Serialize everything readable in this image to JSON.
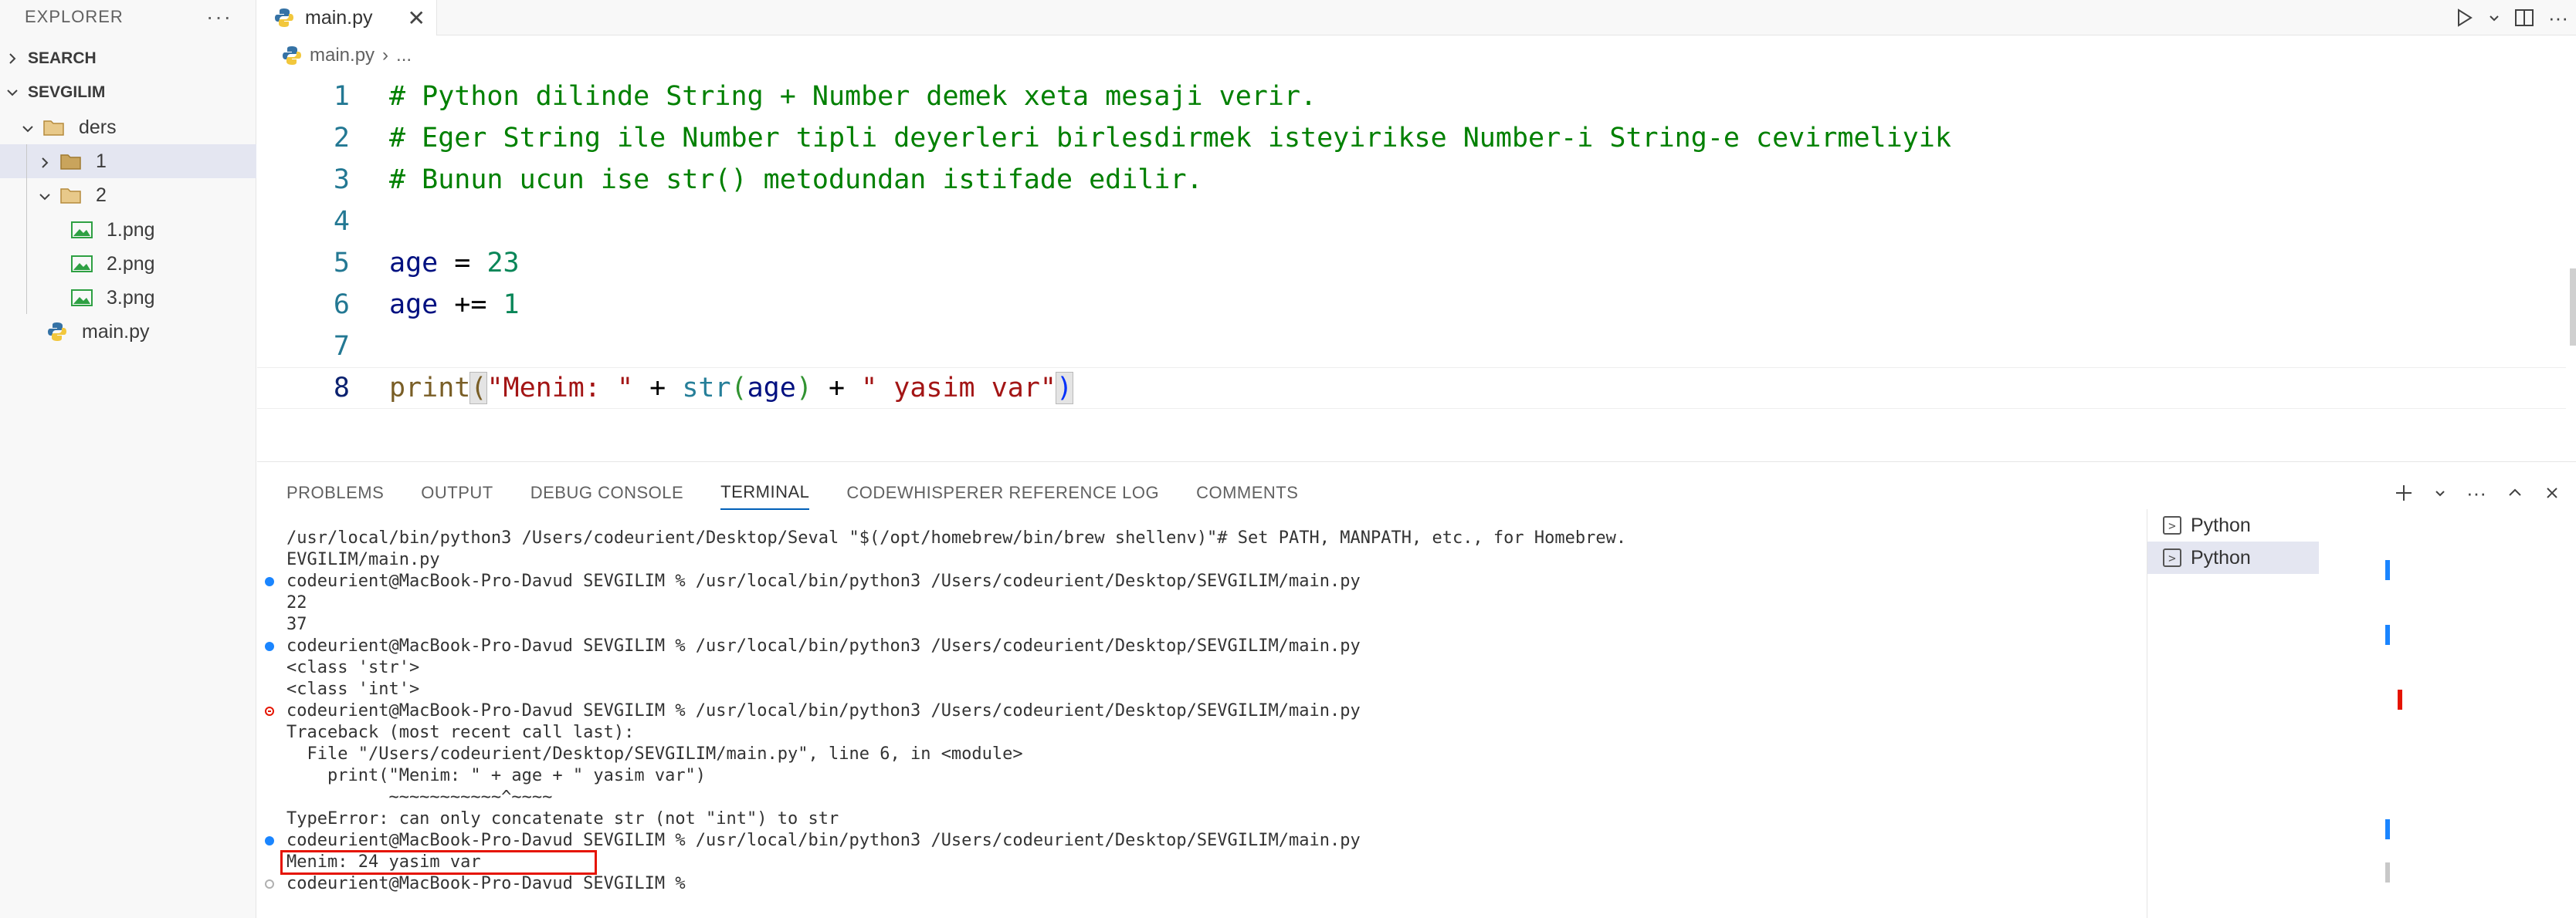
{
  "sidebar": {
    "title": "EXPLORER",
    "more": "···",
    "search_label": "SEARCH",
    "workspace_label": "SEVGILIM",
    "tree": [
      {
        "label": "ders"
      },
      {
        "label": "1"
      },
      {
        "label": "2"
      },
      {
        "label": "1.png"
      },
      {
        "label": "2.png"
      },
      {
        "label": "3.png"
      },
      {
        "label": "main.py"
      }
    ]
  },
  "editor": {
    "tab_label": "main.py",
    "close_glyph": "✕",
    "breadcrumb": {
      "file": "main.py",
      "sep": "›",
      "more": "..."
    },
    "more_glyph": "···",
    "line_numbers": [
      "1",
      "2",
      "3",
      "4",
      "5",
      "6",
      "7",
      "8"
    ],
    "lines": {
      "l1": "# Python dilinde String + Number demek xeta mesaji verir.",
      "l2": "# Eger String ile Number tipli deyerleri birlesdirmek isteyirikse Number-i String-e cevirmeliyik",
      "l3": "# Bunun ucun ise str() metodundan istifade edilir.",
      "l5_var": "age",
      "l5_op": " = ",
      "l5_num": "23",
      "l6_var": "age",
      "l6_op": " += ",
      "l6_num": "1",
      "l8_fn": "print",
      "l8_p1": "(",
      "l8_s1": "\"Menim: \"",
      "l8_plus1": " + ",
      "l8_bi": "str",
      "l8_p2": "(",
      "l8_arg": "age",
      "l8_p3": ")",
      "l8_plus2": " + ",
      "l8_s2": "\" yasim var\"",
      "l8_p4": ")"
    }
  },
  "panel": {
    "tabs": [
      "PROBLEMS",
      "OUTPUT",
      "DEBUG CONSOLE",
      "TERMINAL",
      "CODEWHISPERER REFERENCE LOG",
      "COMMENTS"
    ],
    "active_tab": "TERMINAL",
    "terminal_lines": [
      "/usr/local/bin/python3 /Users/codeurient/Desktop/Seval \"$(/opt/homebrew/bin/brew shellenv)\"# Set PATH, MANPATH, etc., for Homebrew.",
      "EVGILIM/main.py",
      "codeurient@MacBook-Pro-Davud SEVGILIM % /usr/local/bin/python3 /Users/codeurient/Desktop/SEVGILIM/main.py",
      "22",
      "37",
      "codeurient@MacBook-Pro-Davud SEVGILIM % /usr/local/bin/python3 /Users/codeurient/Desktop/SEVGILIM/main.py",
      "<class 'str'>",
      "<class 'int'>",
      "codeurient@MacBook-Pro-Davud SEVGILIM % /usr/local/bin/python3 /Users/codeurient/Desktop/SEVGILIM/main.py",
      "Traceback (most recent call last):",
      "  File \"/Users/codeurient/Desktop/SEVGILIM/main.py\", line 6, in <module>",
      "    print(\"Menim: \" + age + \" yasim var\")",
      "          ~~~~~~~~~~~^~~~~",
      "TypeError: can only concatenate str (not \"int\") to str",
      "codeurient@MacBook-Pro-Davud SEVGILIM % /usr/local/bin/python3 /Users/codeurient/Desktop/SEVGILIM/main.py",
      "Menim: 24 yasim var",
      "codeurient@MacBook-Pro-Davud SEVGILIM % "
    ],
    "terminals": [
      "Python",
      "Python"
    ]
  },
  "colors": {
    "accent": "#005fb8",
    "error": "#e51400",
    "success_dot": "#1a85ff",
    "selection": "#e4e6f1"
  },
  "icons": [
    "python-icon",
    "folder-icon",
    "image-icon",
    "run-icon",
    "split-editor-icon",
    "add-terminal-icon",
    "chevron-up-icon",
    "close-icon",
    "terminal-icon"
  ]
}
